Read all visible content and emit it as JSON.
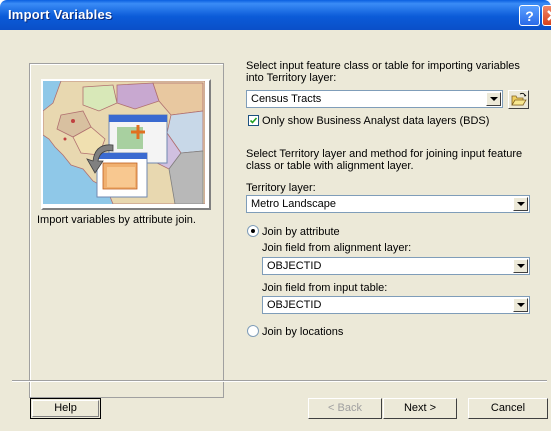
{
  "window": {
    "title": "Import Variables"
  },
  "left_panel": {
    "caption": "Import variables by attribute join."
  },
  "input": {
    "prompt": "Select input feature class or table for importing variables into Territory layer:",
    "selected": "Census Tracts",
    "filter_checkbox_label": "Only show Business Analyst data layers (BDS)",
    "filter_checked": true
  },
  "territory": {
    "prompt": "Select Territory layer and method for joining input feature class or table with alignment layer.",
    "layer_label": "Territory layer:",
    "layer_selected": "Metro Landscape"
  },
  "join": {
    "by_attribute_label": "Join by attribute",
    "alignment_field_label": "Join field from alignment layer:",
    "alignment_field_value": "OBJECTID",
    "input_field_label": "Join field from input table:",
    "input_field_value": "OBJECTID",
    "by_location_label": "Join by locations",
    "selected_method": "attribute"
  },
  "buttons": {
    "help": "Help",
    "back": "< Back",
    "next": "Next >",
    "cancel": "Cancel"
  },
  "icons": [
    "help-icon",
    "close-icon",
    "folder-open-icon",
    "chevron-down-icon",
    "import-map-illustration"
  ]
}
